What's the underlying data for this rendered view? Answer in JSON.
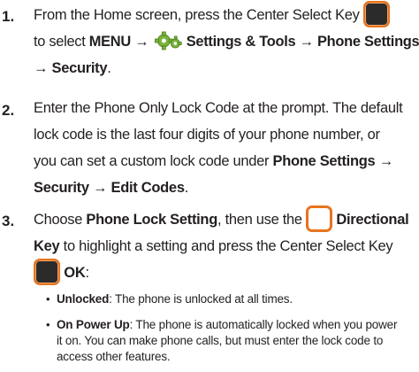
{
  "steps": [
    {
      "number": "1.",
      "line1": "From the Home screen, press the Center Select Key",
      "line2_pre": "to select",
      "menu": "MENU",
      "arrow": "→",
      "settings_tools": "Settings & Tools",
      "phone_settings": "Phone Settings",
      "security": "Security",
      "period": "."
    },
    {
      "number": "2.",
      "line1": "Enter the Phone Only Lock Code at the prompt. The default",
      "line2": "lock code is the last four digits of your phone number, or",
      "line3_pre": "you can set a custom lock code under",
      "phone_settings": "Phone Settings",
      "arrow": "→",
      "security": "Security",
      "edit_codes": "Edit Codes",
      "period": "."
    },
    {
      "number": "3.",
      "pre": "Choose",
      "phone_lock_setting": "Phone Lock Setting",
      "mid": ", then use the",
      "directional": "Directional",
      "key": "Key",
      "line2_rest": "to highlight a setting and press the Center Select Key",
      "ok": "OK",
      "colon": ":"
    }
  ],
  "bullets": [
    {
      "term": "Unlocked",
      "line1": ": The phone is unlocked at all times."
    },
    {
      "term": "On Power Up",
      "line1": ": The phone is automatically locked when you power",
      "line2": "it on. You can make phone calls, but must enter the lock code to",
      "line3": "access other features."
    }
  ],
  "icons": {
    "center_key": "center-select-key-icon",
    "directional_key": "directional-key-icon",
    "settings": "settings-gear-icon"
  },
  "colors": {
    "accent_orange": "#e8731e",
    "key_dark": "#2b2b2b",
    "text": "#231f20"
  }
}
